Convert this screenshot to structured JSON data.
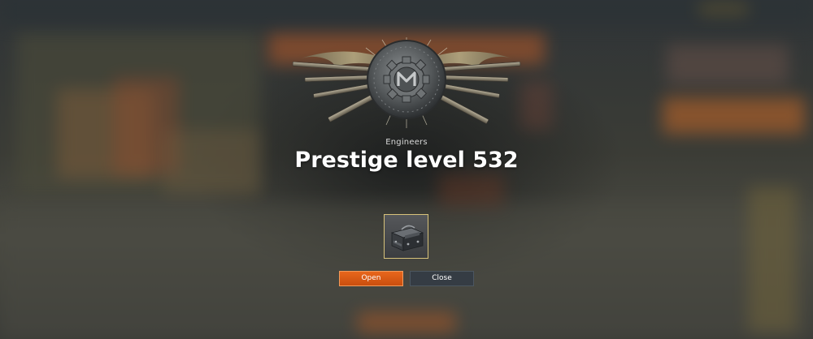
{
  "faction": "Engineers",
  "prestige_title": "Prestige level 532",
  "reward": {
    "icon": "ammo-crate-icon",
    "frame_color": "#d7c27a"
  },
  "buttons": {
    "open_label": "Open",
    "close_label": "Close"
  },
  "colors": {
    "open_button": "#e06018",
    "close_button": "#353c44",
    "title_text": "#ffffff"
  },
  "emblem": {
    "icon": "engineers-gear-emblem-icon"
  }
}
